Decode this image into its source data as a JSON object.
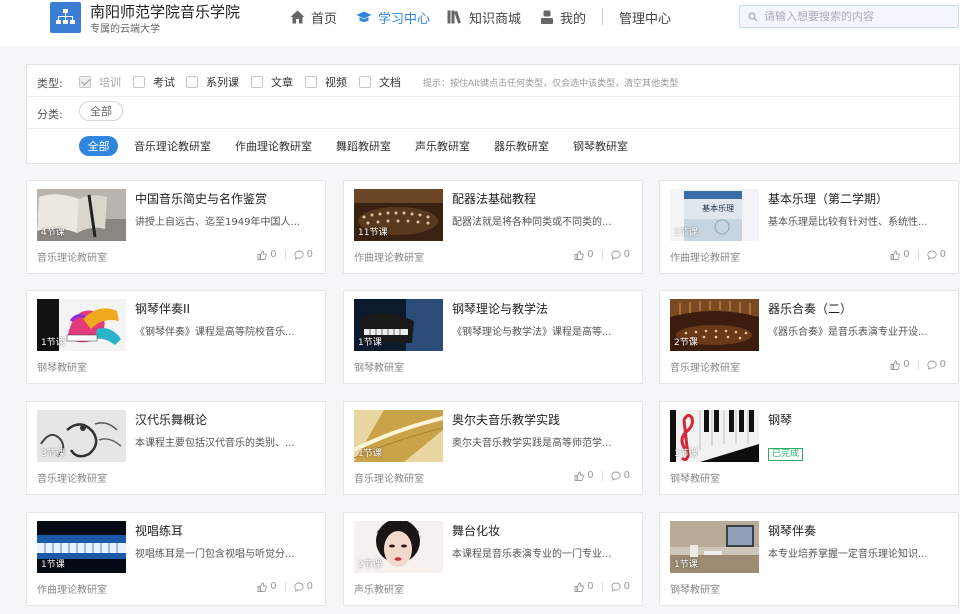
{
  "site": {
    "title": "南阳师范学院音乐学院",
    "subtitle": "专属的云端大学"
  },
  "nav": [
    {
      "label": "首页",
      "icon": "home-icon"
    },
    {
      "label": "学习中心",
      "icon": "graduation-cap-icon",
      "active": true
    },
    {
      "label": "知识商城",
      "icon": "books-icon"
    },
    {
      "label": "我的",
      "icon": "user-icon"
    },
    {
      "label": "管理中心"
    }
  ],
  "search": {
    "placeholder": "请输入想要搜索的内容"
  },
  "filter": {
    "type_label": "类型:",
    "types": [
      {
        "label": "培训",
        "checked": true
      },
      {
        "label": "考试",
        "checked": false
      },
      {
        "label": "系列课",
        "checked": false
      },
      {
        "label": "文章",
        "checked": false
      },
      {
        "label": "视频",
        "checked": false
      },
      {
        "label": "文档",
        "checked": false
      }
    ],
    "hint": "提示：按住Alt键点击任何类型，仅会选中该类型，清空其他类型",
    "category_label": "分类:",
    "category_all": "全部",
    "departments": [
      "全部",
      "音乐理论教研室",
      "作曲理论教研室",
      "舞蹈教研室",
      "声乐教研室",
      "器乐教研室",
      "钢琴教研室"
    ]
  },
  "courses": [
    {
      "title": "中国音乐简史与名作鉴赏",
      "desc": "讲授上自远古、迄至1949年中国人...",
      "lessons": "4节课",
      "dept": "音乐理论教研室",
      "likes": "0",
      "comments": "0",
      "thumb": "book-pen"
    },
    {
      "title": "配器法基础教程",
      "desc": "配器法就是将各种同类或不同类的...",
      "lessons": "11节课",
      "dept": "作曲理论教研室",
      "likes": "0",
      "comments": "0",
      "thumb": "orchestra"
    },
    {
      "title": "基本乐理（第二学期）",
      "desc": "基本乐理是比较有针对性、系统性...",
      "lessons": "1节课",
      "dept": "作曲理论教研室",
      "likes": "0",
      "comments": "0",
      "thumb": "textbook",
      "thumb_text": "基本乐理"
    },
    {
      "title": "钢琴伴奏II",
      "desc": "《钢琴伴奏》课程是高等院校音乐...",
      "lessons": "1节课",
      "dept": "钢琴教研室",
      "thumb": "colorful-piano"
    },
    {
      "title": "钢琴理论与教学法",
      "desc": "《钢琴理论与教学法》课程是高等...",
      "lessons": "1节课",
      "dept": "钢琴教研室",
      "thumb": "grand-piano"
    },
    {
      "title": "器乐合奏（二）",
      "desc": "《器乐合奏》是音乐表演专业开设...",
      "lessons": "2节课",
      "dept": "音乐理论教研室",
      "likes": "0",
      "comments": "0",
      "thumb": "concert-hall"
    },
    {
      "title": "汉代乐舞概论",
      "desc": "本课程主要包括汉代音乐的类别、...",
      "lessons": "3节课",
      "dept": "音乐理论教研室",
      "thumb": "ink-dance"
    },
    {
      "title": "奥尔夫音乐教学实践",
      "desc": "奥尔夫音乐教学实践是高等师范学...",
      "lessons": "1节课",
      "dept": "音乐理论教研室",
      "likes": "0",
      "comments": "0",
      "thumb": "golden-sheet"
    },
    {
      "title": "钢琴",
      "badge": "已完成",
      "lessons": "1节课",
      "dept": "钢琴教研室",
      "thumb": "keys-clef"
    },
    {
      "title": "视唱练耳",
      "desc": "视唱练耳是一门包含视唱与听觉分...",
      "lessons": "1节课",
      "dept": "作曲理论教研室",
      "likes": "0",
      "comments": "0",
      "thumb": "blue-keys"
    },
    {
      "title": "舞台化妆",
      "desc": "本课程是音乐表演专业的一门专业...",
      "lessons": "2节课",
      "dept": "声乐教研室",
      "likes": "0",
      "comments": "0",
      "thumb": "portrait"
    },
    {
      "title": "钢琴伴奏",
      "desc": "本专业培养掌握一定音乐理论知识...",
      "lessons": "1节课",
      "dept": "钢琴教研室",
      "thumb": "desk"
    }
  ]
}
